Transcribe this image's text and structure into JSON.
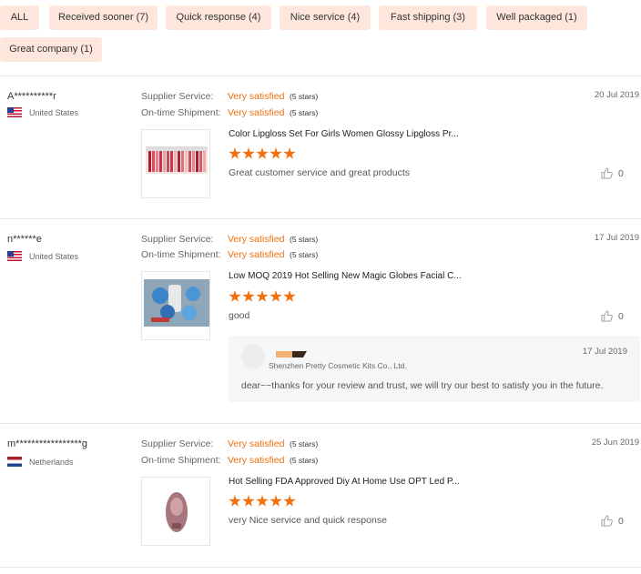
{
  "filters": [
    "ALL",
    "Received sooner (7)",
    "Quick response (4)",
    "Nice service (4)",
    "Fast shipping (3)",
    "Well packaged (1)",
    "Great company (1)"
  ],
  "labels": {
    "supplier_service": "Supplier Service:",
    "ontime_shipment": "On-time Shipment:"
  },
  "colors": {
    "accent": "#f2700c",
    "chip_bg": "#fde7dc"
  },
  "reviews": [
    {
      "name": "A**********r",
      "country": "United States",
      "flag": "us",
      "date": "20 Jul 2019",
      "supplier_rating": "Very satisfied",
      "supplier_stars": "(5 stars)",
      "shipment_rating": "Very satisfied",
      "shipment_stars": "(5 stars)",
      "product_title": "Color Lipgloss Set For Girls Women Glossy Lipgloss Pr...",
      "rating": 5,
      "comment": "Great customer service and great products",
      "likes": "0"
    },
    {
      "name": "n******e",
      "country": "United States",
      "flag": "us",
      "date": "17 Jul 2019",
      "supplier_rating": "Very satisfied",
      "supplier_stars": "(5 stars)",
      "shipment_rating": "Very satisfied",
      "shipment_stars": "(5 stars)",
      "product_title": "Low MOQ 2019 Hot Selling New Magic Globes Facial C...",
      "rating": 5,
      "comment": "good",
      "likes": "0",
      "reply": {
        "company": "Shenzhen Pretty Cosmetic Kits Co., Ltd.",
        "date": "17 Jul 2019",
        "text": "dear~~thanks for your review and trust, we will try our best to satisfy you in the future."
      }
    },
    {
      "name": "m*****************g",
      "country": "Netherlands",
      "flag": "nl",
      "date": "25 Jun 2019",
      "supplier_rating": "Very satisfied",
      "supplier_stars": "(5 stars)",
      "shipment_rating": "Very satisfied",
      "shipment_stars": "(5 stars)",
      "product_title": "Hot Selling FDA Approved Diy At Home Use OPT Led P...",
      "rating": 5,
      "comment": "very Nice service and quick response",
      "likes": "0"
    }
  ]
}
